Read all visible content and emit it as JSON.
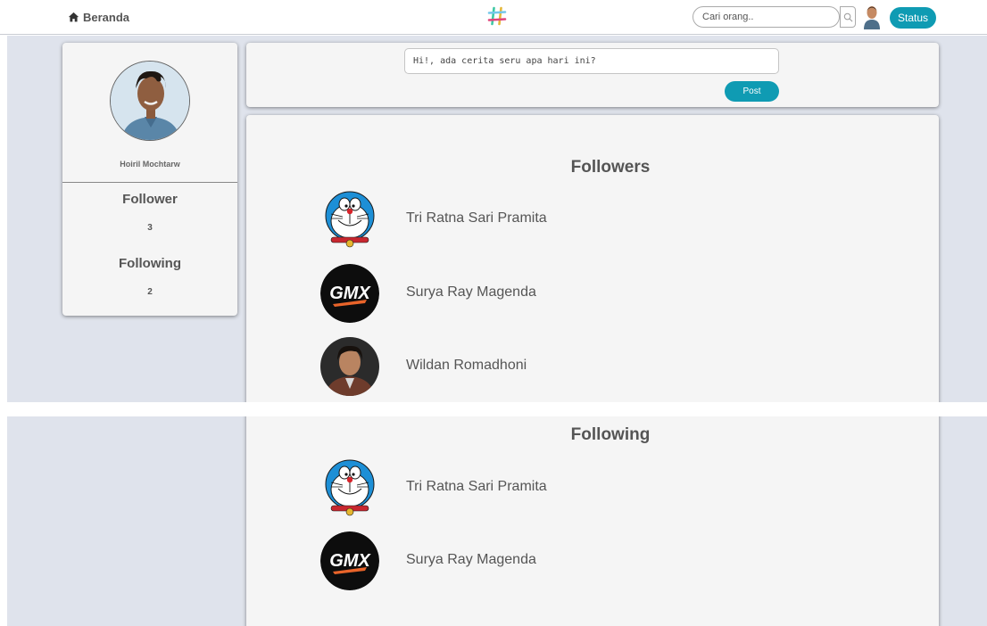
{
  "header": {
    "home_label": "Beranda",
    "search_placeholder": "Cari orang..",
    "status_label": "Status",
    "accent_color": "#0f9bb3"
  },
  "profile": {
    "name": "Hoiril Mochtarw",
    "follower_label": "Follower",
    "follower_count": "3",
    "following_label": "Following",
    "following_count": "2"
  },
  "composer": {
    "value": "Hi!, ada cerita seru apa hari ini?",
    "post_label": "Post"
  },
  "followers": {
    "title": "Followers",
    "items": [
      {
        "name": "Tri Ratna Sari Pramita",
        "avatar": "doraemon-avatar"
      },
      {
        "name": "Surya Ray Magenda",
        "avatar": "gmx-logo-avatar"
      },
      {
        "name": "Wildan Romadhoni",
        "avatar": "photo-avatar"
      }
    ]
  },
  "following": {
    "title": "Following",
    "items": [
      {
        "name": "Tri Ratna Sari Pramita",
        "avatar": "doraemon-avatar"
      },
      {
        "name": "Surya Ray Magenda",
        "avatar": "gmx-logo-avatar"
      }
    ]
  },
  "icons": {
    "home": "home-icon",
    "logo": "hashtag-logo-icon",
    "search": "search-icon"
  }
}
